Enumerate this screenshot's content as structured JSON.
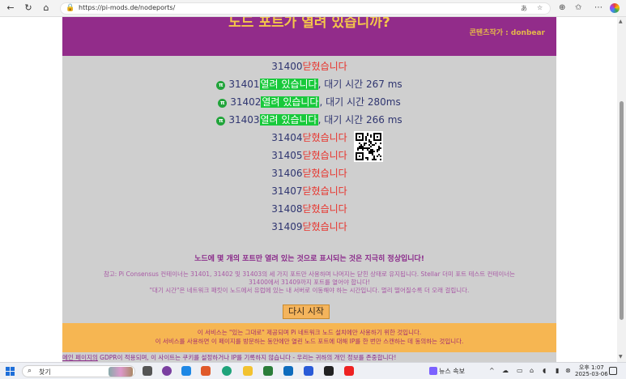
{
  "browser": {
    "url": "https://pi-mods.de/nodeports/"
  },
  "header": {
    "title": "노드 포트가 열려 있습니까?",
    "creator": "콘텐츠작가 : donbear"
  },
  "ports": [
    {
      "num": "31400",
      "status": "닫혔습니다",
      "open": false,
      "wait": ""
    },
    {
      "num": "31401",
      "status": "열려 있습니다",
      "open": true,
      "wait": ", 대기 시간 267 ms"
    },
    {
      "num": "31402",
      "status": "열려 있습니다",
      "open": true,
      "wait": ", 대기 시간 280ms"
    },
    {
      "num": "31403",
      "status": "열려 있습니다",
      "open": true,
      "wait": ", 대기 시간 266 ms"
    },
    {
      "num": "31404",
      "status": "닫혔습니다",
      "open": false,
      "wait": ""
    },
    {
      "num": "31405",
      "status": "닫혔습니다",
      "open": false,
      "wait": ""
    },
    {
      "num": "31406",
      "status": "닫혔습니다",
      "open": false,
      "wait": ""
    },
    {
      "num": "31407",
      "status": "닫혔습니다",
      "open": false,
      "wait": ""
    },
    {
      "num": "31408",
      "status": "닫혔습니다",
      "open": false,
      "wait": ""
    },
    {
      "num": "31409",
      "status": "닫혔습니다",
      "open": false,
      "wait": ""
    }
  ],
  "pi_icon": "π",
  "messages": {
    "normal": "노드에 몇 개의 포트만 열려 있는 것으로 표시되는 것은 지극히 정상입니다!",
    "note1": "참고: Pi Consensus 컨테이너는 31401, 31402 및 31403의 세 가지 포트만 사용하며 나머지는 닫힌 상태로 유지됩니다. Stellar 더미 포트 테스트 컨테이너는",
    "note2": "31400에서 31409까지 포트를 열어야 합니다!",
    "note3": "\"대기 시간\"은 네트워크 패킷이 노드에서 유럽에 있는 내 서버로 이동해야 하는 시간입니다. 멀리 떨어질수록 더 오래 걸립니다.",
    "retry": "다시 시작"
  },
  "footer": {
    "line1": "이 서비스는 \"있는 그대로\" 제공되며 Pi 네트워크 노드 설치에만 사용하기 위한 것입니다.",
    "line2": "이 서비스를 사용하면 이 페이지를 방문하는 동안에만 열린 노드 포트에 대해 IP를 한 번만 스캔하는 데 동의하는 것입니다.",
    "gdpr_link": "메인 페이지의",
    "gdpr_text": " GDPR이 적용되며, 이 사이트는 쿠키를 설정하거나 IP를 기록하지 않습니다 - 우리는 귀하의 개인 정보를 존중합니다!"
  },
  "taskbar": {
    "search_placeholder": "찾기",
    "news": "뉴스 속보",
    "time": "오후 1:07",
    "date": "2025-03-06"
  }
}
